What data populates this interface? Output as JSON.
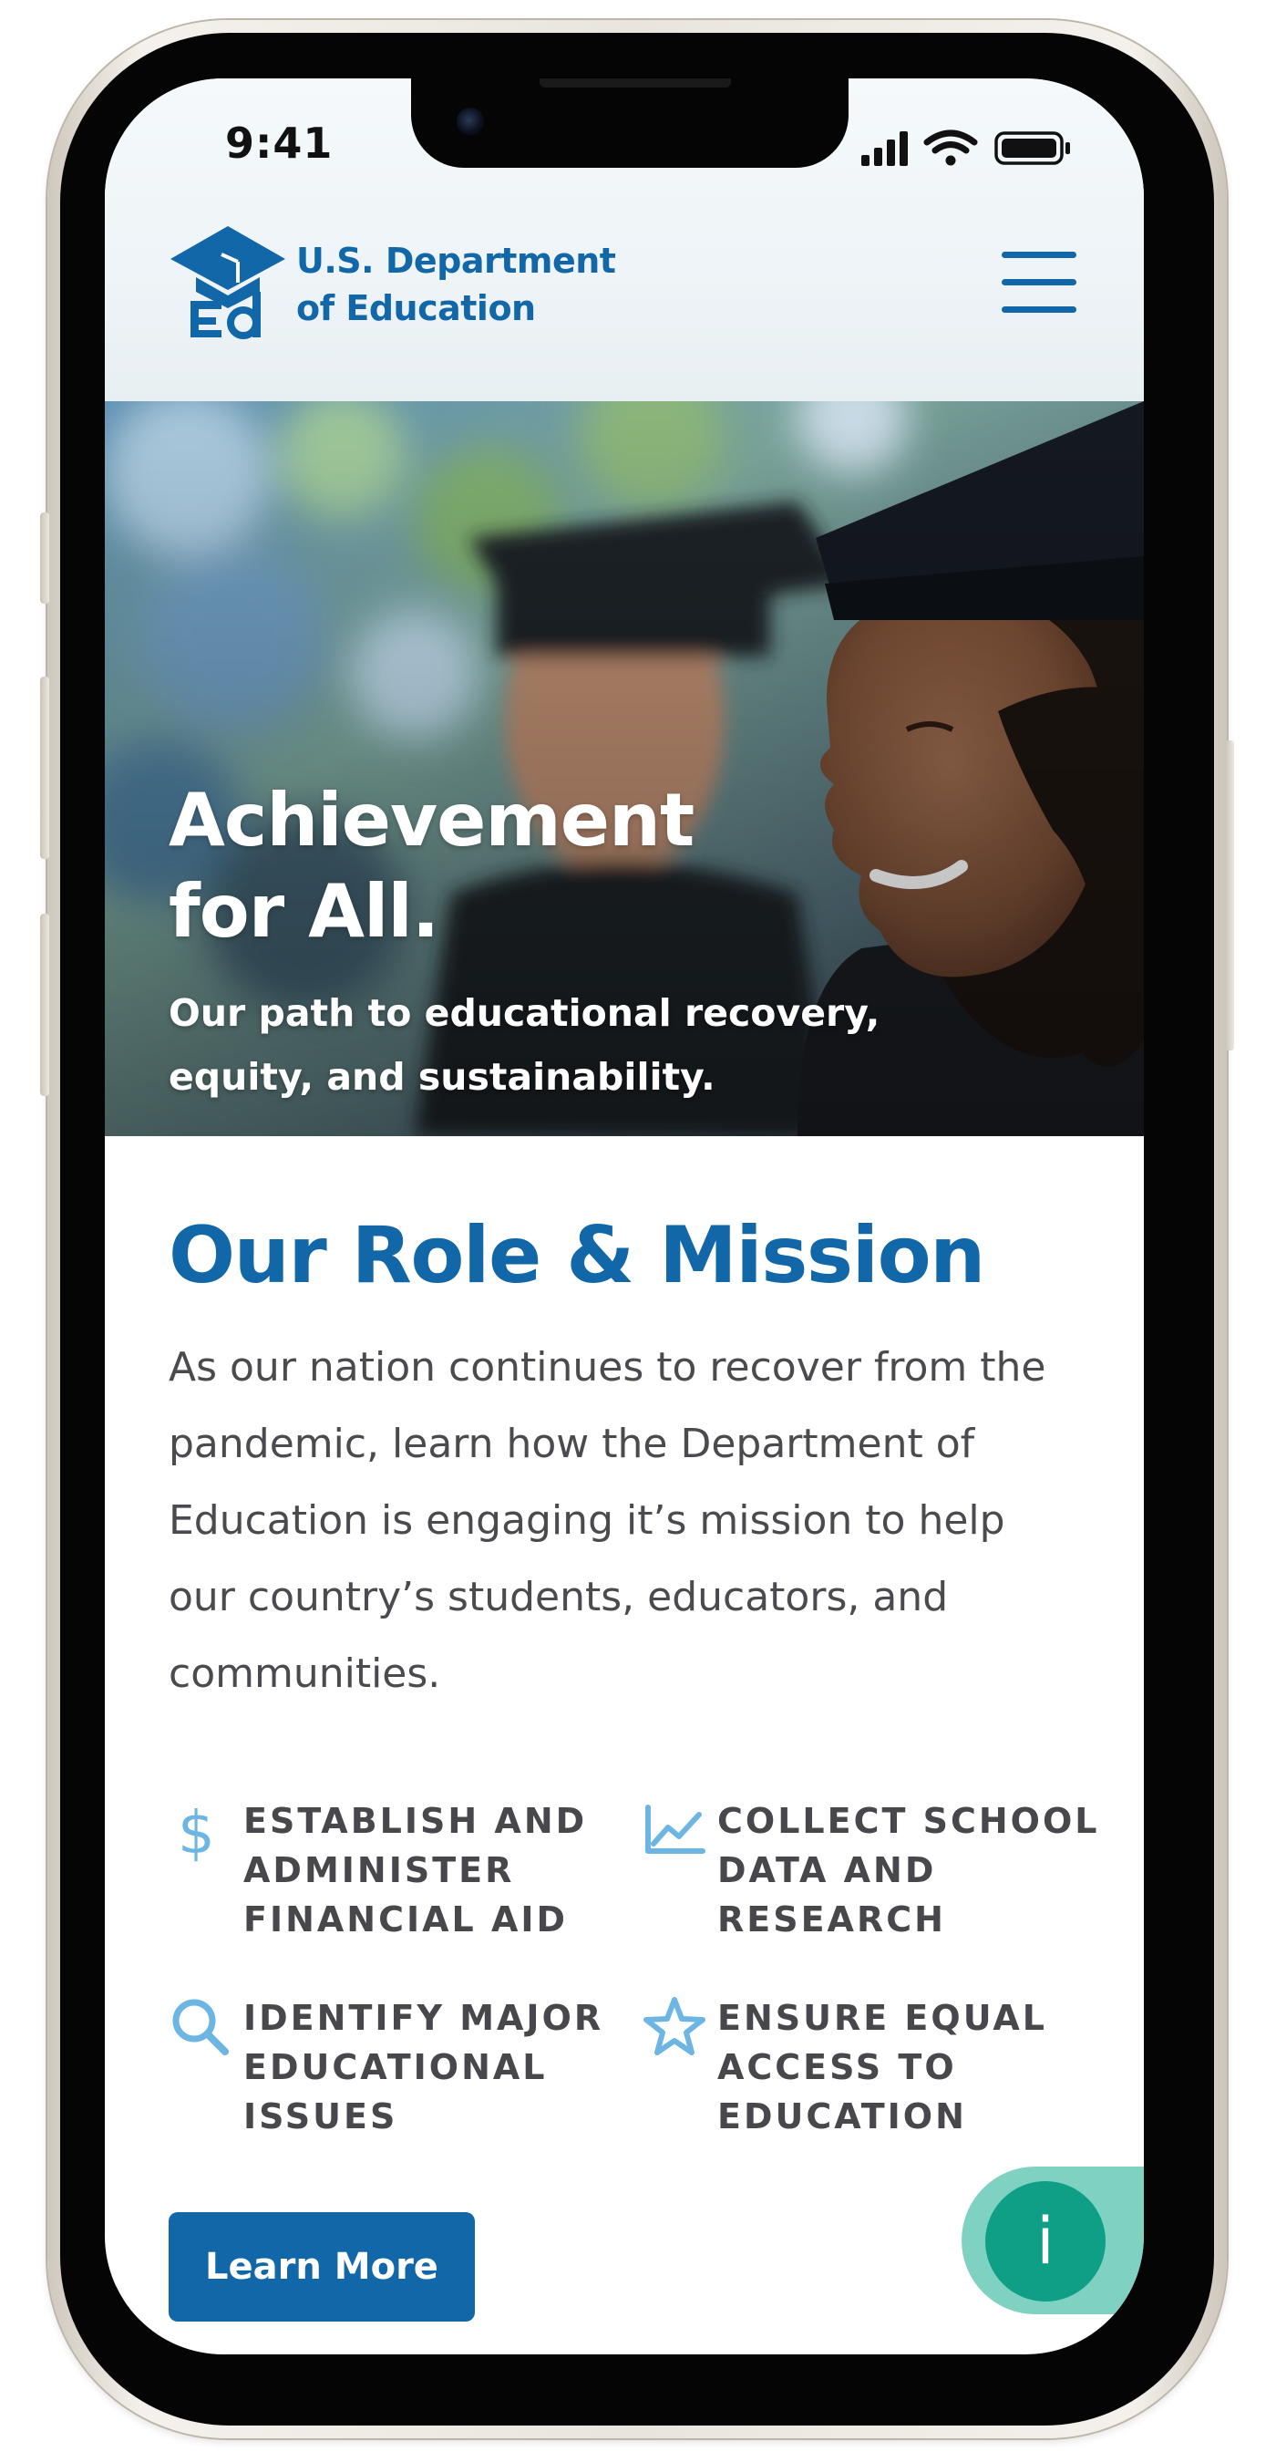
{
  "status_bar": {
    "time": "9:41"
  },
  "header": {
    "logo_line1": "U.S. Department",
    "logo_line2": "of Education",
    "menu_icon": "hamburger-icon"
  },
  "hero": {
    "title_line1": "Achievement",
    "title_line2": "for All.",
    "subtitle": "Our path to educational recovery, equity, and sustainability."
  },
  "mission": {
    "title": "Our Role & Mission",
    "body": "As our nation continues to recover from the pandemic, learn how the Department of Education is engaging it’s mission to help our country’s students, educators, and communities.",
    "features": [
      {
        "icon": "dollar-icon",
        "label": "ESTABLISH AND ADMINISTER FINANCIAL AID"
      },
      {
        "icon": "line-chart-icon",
        "label": "COLLECT SCHOOL DATA AND RESEARCH"
      },
      {
        "icon": "search-icon",
        "label": "IDENTIFY MAJOR EDUCATIONAL ISSUES"
      },
      {
        "icon": "star-icon",
        "label": "ENSURE EQUAL ACCESS TO EDUCATION"
      }
    ],
    "cta_label": "Learn More"
  },
  "info_widget": {
    "label": "i"
  },
  "colors": {
    "brand_blue": "#1167a8",
    "icon_light_blue": "#6db6e4",
    "info_green": "#0f9e86",
    "info_tab": "#7fd1c2",
    "body_text": "#4a4a4f"
  }
}
